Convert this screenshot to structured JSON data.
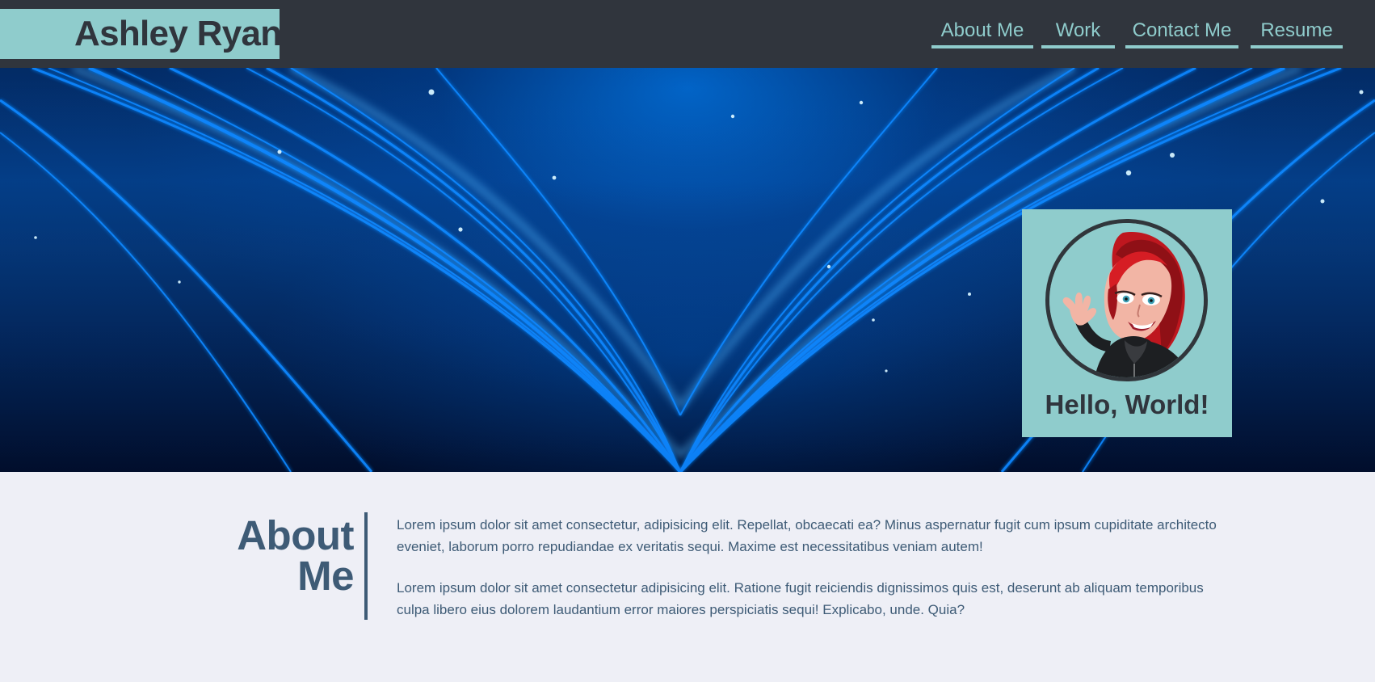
{
  "header": {
    "title": "Ashley Ryan",
    "nav": [
      {
        "label": "About Me"
      },
      {
        "label": "Work"
      },
      {
        "label": "Contact Me"
      },
      {
        "label": "Resume"
      }
    ]
  },
  "hero": {
    "card_text": "Hello, World!",
    "icons": {
      "avatar": "avatar-icon"
    }
  },
  "about": {
    "heading_line1": "About",
    "heading_line2": "Me",
    "paragraphs": [
      "Lorem ipsum dolor sit amet consectetur, adipisicing elit. Repellat, obcaecati ea? Minus aspernatur fugit cum ipsum cupiditate architecto eveniet, laborum porro repudiandae ex veritatis sequi. Maxime est necessitatibus veniam autem!",
      "Lorem ipsum dolor sit amet consectetur adipisicing elit. Ratione fugit reiciendis dignissimos quis est, deserunt ab aliquam temporibus culpa libero eius dolorem laudantium error maiores perspiciatis sequi! Explicabo, unde. Quia?"
    ]
  },
  "colors": {
    "header_bg": "#30353d",
    "accent": "#8fcccc",
    "heading": "#3e5b76",
    "section_bg": "#eeeff6"
  }
}
